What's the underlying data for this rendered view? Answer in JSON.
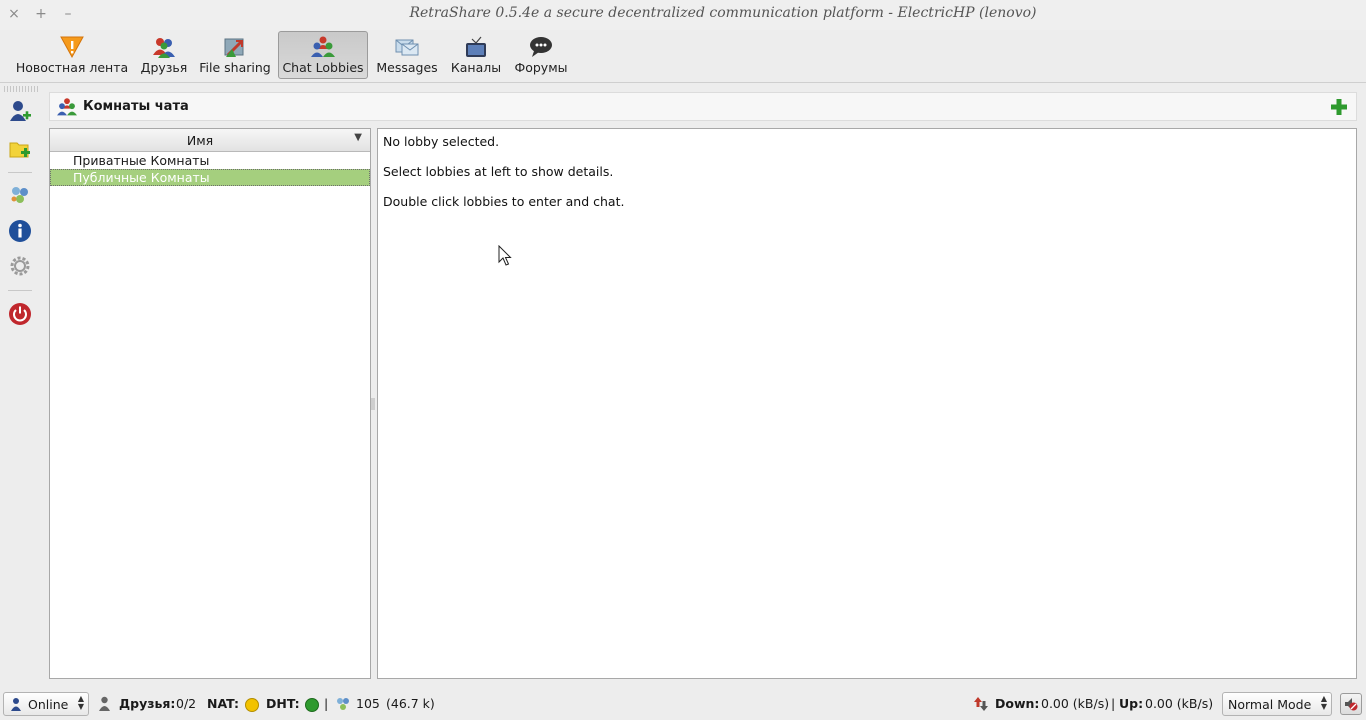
{
  "window": {
    "title": "RetraShare 0.5.4e a secure decentralized communication platform - ElectricHP (lenovo)",
    "controls": [
      "×",
      "+",
      "–"
    ]
  },
  "toolbar": {
    "items": [
      {
        "label": "Новостная лента",
        "icon": "news-warning-icon",
        "active": false
      },
      {
        "label": "Друзья",
        "icon": "friends-icon",
        "active": false
      },
      {
        "label": "File sharing",
        "icon": "file-sharing-icon",
        "active": false
      },
      {
        "label": "Chat Lobbies",
        "icon": "chat-lobbies-icon",
        "active": true
      },
      {
        "label": "Messages",
        "icon": "messages-icon",
        "active": false
      },
      {
        "label": "Каналы",
        "icon": "channels-tv-icon",
        "active": false
      },
      {
        "label": "Форумы",
        "icon": "forums-icon",
        "active": false
      }
    ]
  },
  "sidebar": {
    "items": [
      "add-friend-icon",
      "add-share-icon",
      "network-icon",
      "info-icon",
      "settings-icon",
      "quit-icon"
    ]
  },
  "lobbies": {
    "header_title": "Комнаты чата",
    "column_name": "Имя",
    "sort_indicator": "▼",
    "rows": [
      {
        "label": "Приватные Комнаты",
        "selected": false
      },
      {
        "label": "Публичные Комнаты",
        "selected": true
      }
    ],
    "details": [
      "No lobby selected.",
      "Select lobbies at left to show details.",
      "Double click lobbies to enter and chat."
    ]
  },
  "status": {
    "online_value": "Online",
    "friends_label": "Друзья:",
    "friends_value": "0/2",
    "nat_label": "NAT:",
    "nat_color": "#f2c200",
    "dht_label": "DHT:",
    "dht_color": "#2e9a2e",
    "separator": "|",
    "peers_count": "105",
    "peers_size": "(46.7 k)",
    "down_label": "Down:",
    "down_value": "0.00 (kB/s)",
    "up_sep": "|",
    "up_label": "Up:",
    "up_value": "0.00 (kB/s)",
    "mode_value": "Normal Mode"
  },
  "colors": {
    "selection": "#a5cf7e",
    "accent_green": "#2e9a2e"
  }
}
